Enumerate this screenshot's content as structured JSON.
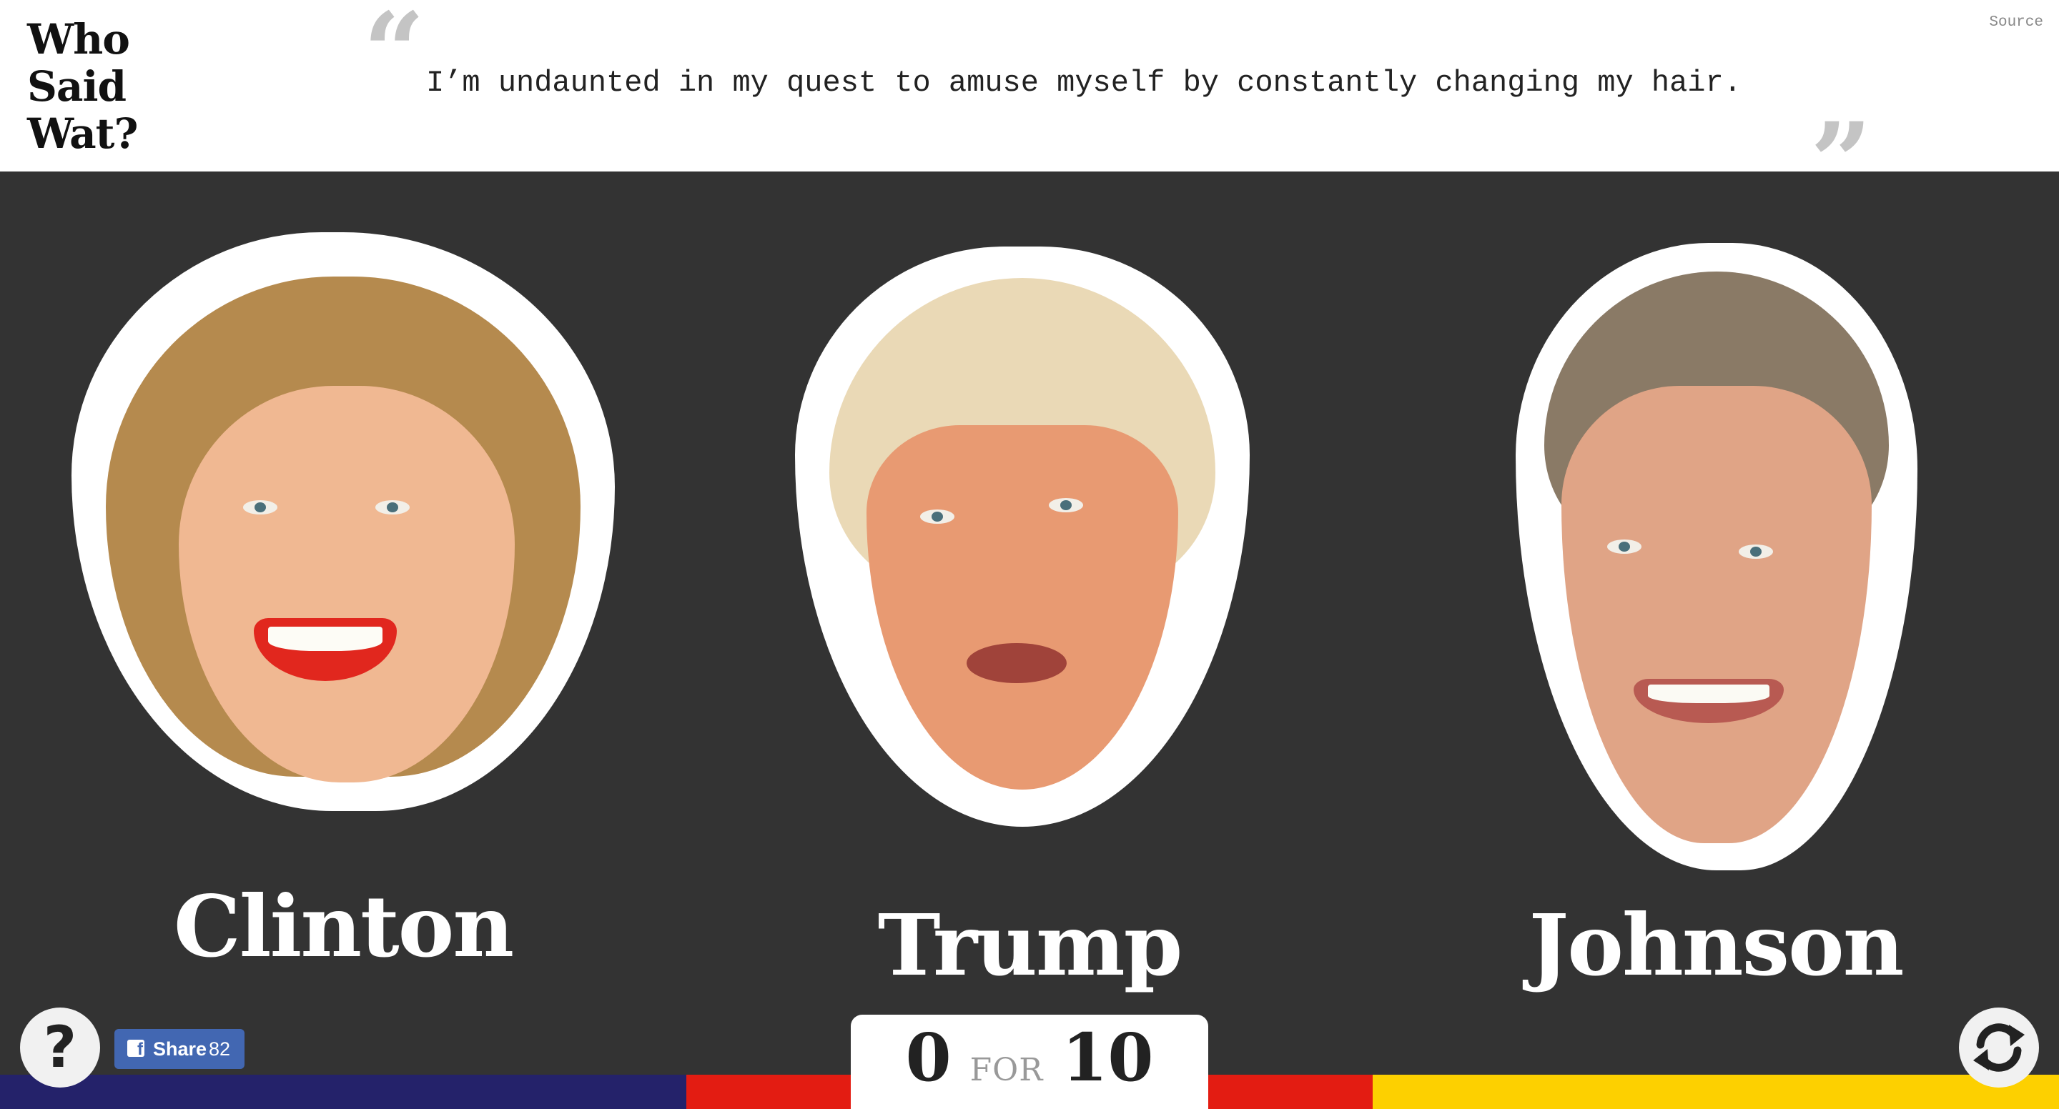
{
  "header": {
    "logo_lines": [
      "Who",
      "Said",
      "Wat?"
    ],
    "quote_text": "I’m undaunted in my quest to amuse myself by constantly changing my hair.",
    "open_quote_glyph": "“",
    "close_quote_glyph": "”",
    "source_label": "Source"
  },
  "candidates": [
    {
      "name": "Clinton",
      "hair_color": "#b58a4e",
      "skin_color": "#f0b892"
    },
    {
      "name": "Trump",
      "hair_color": "#ead9b6",
      "skin_color": "#e89a72"
    },
    {
      "name": "Johnson",
      "hair_color": "#8a7a66",
      "skin_color": "#e0a486"
    }
  ],
  "score": {
    "correct": "0",
    "separator": "FOR",
    "total": "10"
  },
  "footer": {
    "help_label": "?",
    "share_label": "Share",
    "share_count": "82",
    "fb_glyph": "f",
    "stripe_colors": [
      "#24226a",
      "#e31c12",
      "#fdd000"
    ]
  },
  "icons": {
    "help": "question-mark-icon",
    "facebook": "facebook-icon",
    "refresh": "refresh-icon",
    "quote_open": "open-quote-icon",
    "quote_close": "close-quote-icon"
  }
}
